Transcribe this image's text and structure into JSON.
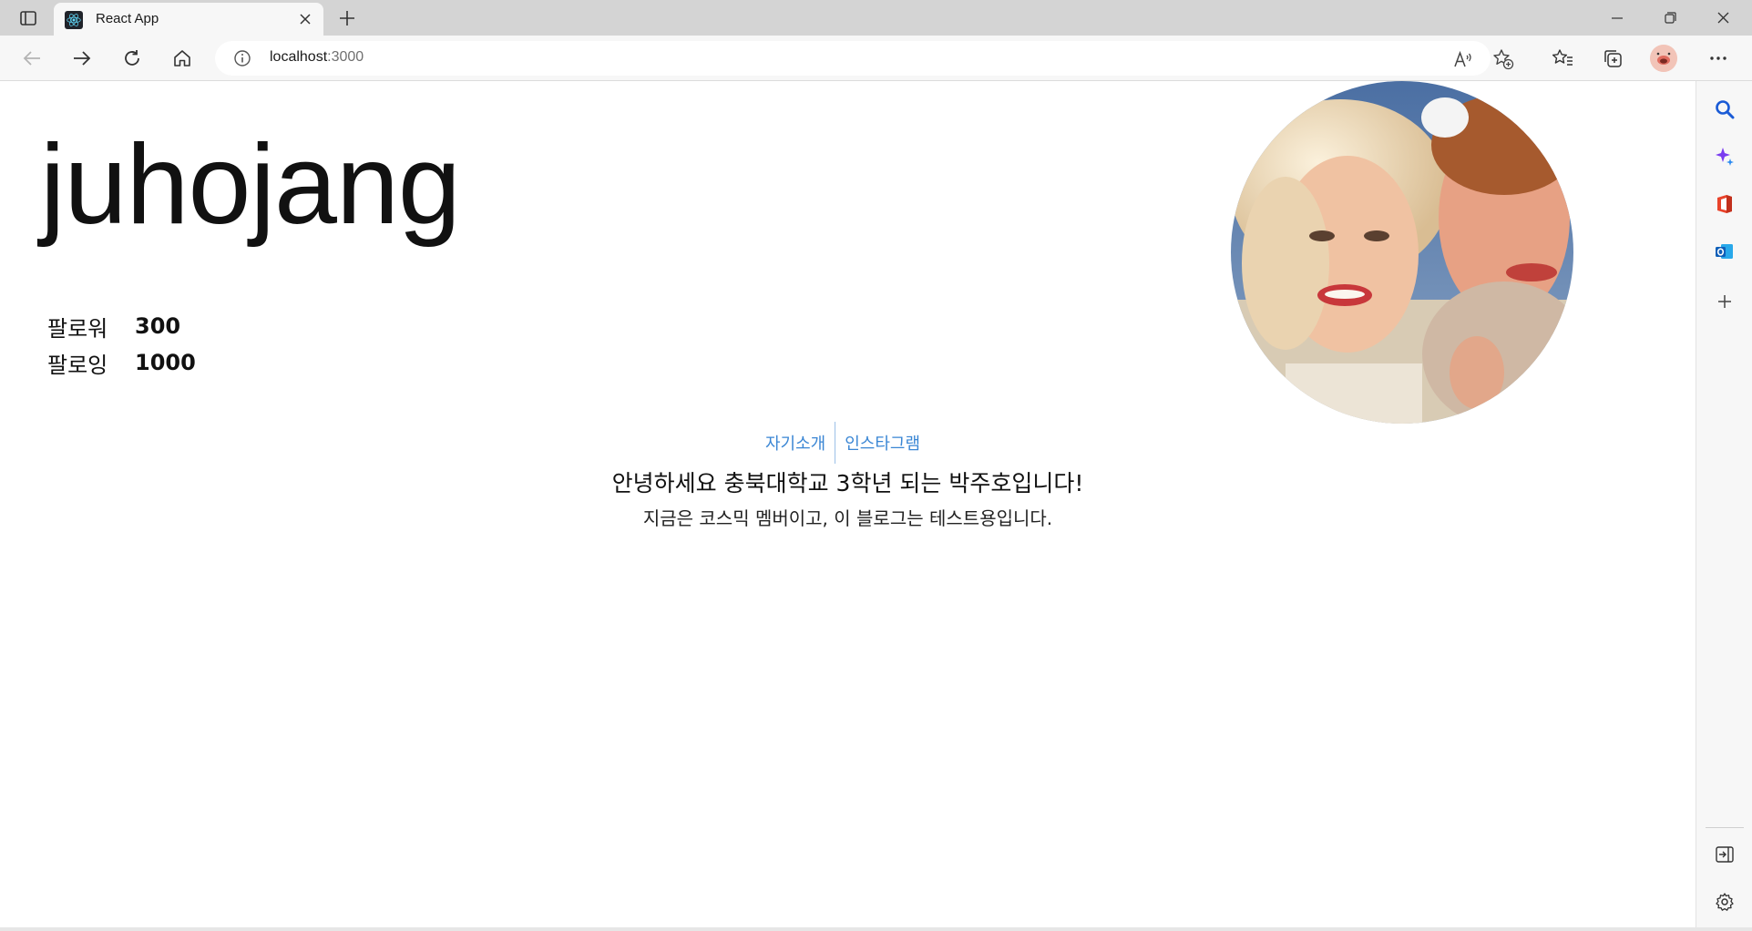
{
  "browser": {
    "tab_title": "React App",
    "address_host": "localhost",
    "address_port": ":3000",
    "icons": {
      "tab_actions": "tab-actions-icon",
      "favicon": "react-logo-icon",
      "close": "close-icon",
      "new_tab": "plus-icon",
      "back": "back-arrow-icon",
      "forward": "forward-arrow-icon",
      "refresh": "refresh-icon",
      "home": "home-icon",
      "info": "info-icon",
      "read_aloud": "read-aloud-icon",
      "add_favorite": "star-plus-icon",
      "favorites": "favorites-icon",
      "collections": "collections-icon",
      "profile": "profile-avatar",
      "more": "more-icon"
    },
    "sidebar_icons": [
      "search-icon",
      "copilot-icon",
      "office-icon",
      "outlook-icon",
      "plus-icon",
      "hide-sidebar-icon",
      "settings-icon"
    ]
  },
  "profile": {
    "username": "juhojang",
    "followers_label": "팔로워",
    "followers_count": "300",
    "following_label": "팔로잉",
    "following_count": "1000"
  },
  "tabs": {
    "intro": "자기소개",
    "instagram": "인스타그램"
  },
  "intro": {
    "title": "안녕하세요 충북대학교 3학년 되는 박주호입니다!",
    "subtitle": "지금은 코스믹 멤버이고, 이 블로그는 테스트용입니다."
  },
  "colors": {
    "link": "#3a86d4",
    "chrome_bg": "#d4d4d4",
    "toolbar_bg": "#f7f7f7"
  }
}
